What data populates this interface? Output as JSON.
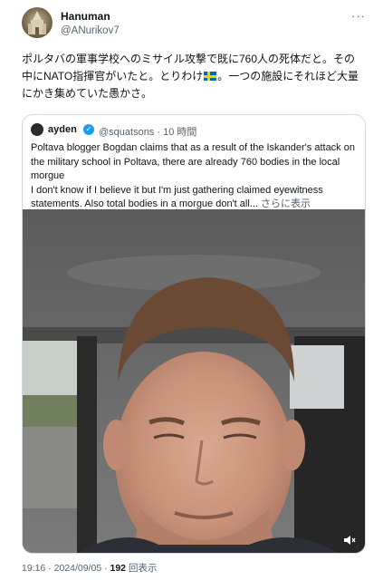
{
  "author": {
    "name": "Hanuman",
    "handle": "@ANurikov7"
  },
  "tweet": {
    "text_part1": "ポルタバの軍事学校へのミサイル攻撃で既に760人の死体だと。その中にNATO指揮官がいたと。とりわけ",
    "flag_icon": "sweden-flag-icon",
    "text_part2": "。一つの施設にそれほど大量にかき集めていた愚かさ。"
  },
  "quoted": {
    "name": "ayden",
    "handle_time": "@squatsons · 10 時間",
    "text_lines": [
      "Poltava blogger Bogdan claims that as a result of the Iskander's attack on the military school in Poltava, there are already 760 bodies in the local morgue",
      "I don't know if I believe it but I'm just gathering claimed eyewitness statements. Also total bodies in a morgue don't all..."
    ],
    "show_more": "さらに表示"
  },
  "footer": {
    "time": "19:16 · 2024/09/05 · ",
    "views_count": "192",
    "views_label": "回表示"
  },
  "colors": {
    "text": "#0f1419",
    "secondary": "#536471",
    "border": "#cfd9de",
    "verified": "#1d9bf0"
  }
}
